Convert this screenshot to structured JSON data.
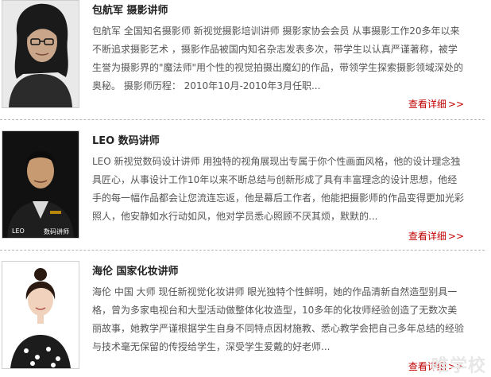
{
  "teachers": [
    {
      "name": "包航军 摄影讲师",
      "description": "包航军 全国知名摄影师 新视觉摄影培训讲师 摄影家协会会员 从事摄影工作20多年以来不断追求摄影艺术 ，摄影作品被国内知名杂志发表多次，带学生以认真严谨著称，被学生誉为摄影界的\"魔法师\"用个性的视觉拍摄出魔幻的作品，带领学生探索摄影领域深处的奥秘。 摄影师历程： 2010年10月-2010年3月任职...",
      "more_label": "查看详细",
      "more_arrow": ">>"
    },
    {
      "name": "LEO 数码讲师",
      "description": "LEO 新视觉数码设计讲师 用独特的视角展现出专属于你个性画面风格，他的设计理念独具匠心，从事设计工作10年以来不断总结与创新形成了具有丰富理念的设计思想，他经手的每一幅作品都会让您流连忘返，他是幕后工作者，他能把摄影师的作品变得更加光彩照人，他安静如水行动如风，他对学员悉心照顾不厌其烦，默默的...",
      "photo_caption_left": "LEO",
      "photo_caption_right": "数码讲师",
      "more_label": "查看详细",
      "more_arrow": ">>"
    },
    {
      "name": "海伦 国家化妆讲师",
      "description": "海伦 中国 大师 现任新视觉化妆讲师 眼光独特个性鲜明，她的作品清新自然造型别具一格，曾为多家电视台和大型活动做整体化妆造型，10多年的化妆师经验创造了无数次美丽故事，她教学严谨根据学生自身不同特点因材施教、悉心教学会把自己多年总结的经验与技术毫无保留的传授给学生，深受学生爱戴的好老师...",
      "more_label": "查看详细",
      "more_arrow": ">>"
    }
  ],
  "watermark": "唯学校",
  "colors": {
    "link": "#c00000",
    "divider": "#b5b5b5"
  }
}
